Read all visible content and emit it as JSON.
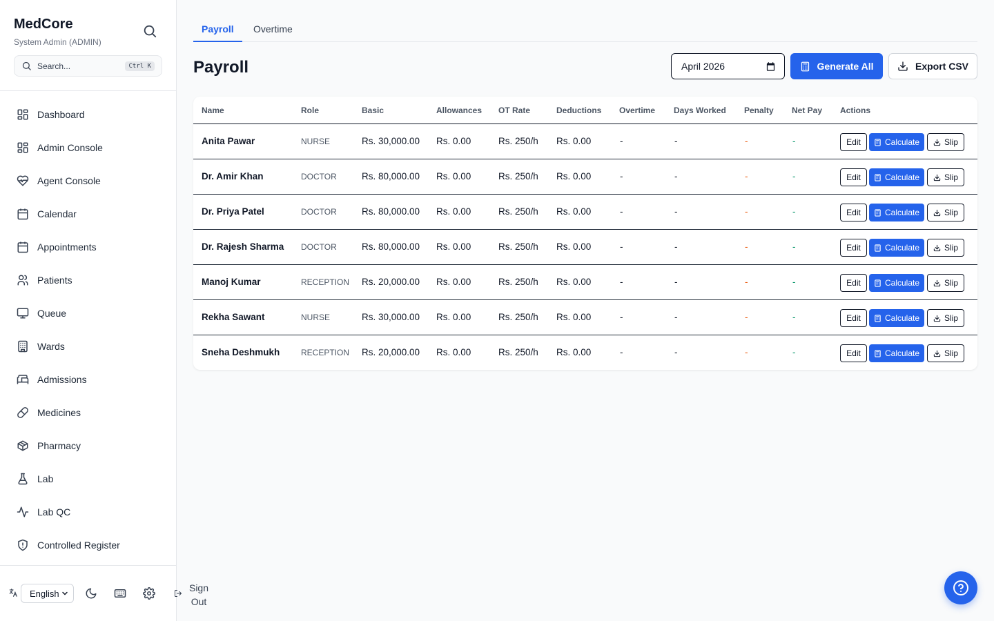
{
  "app": {
    "name": "MedCore",
    "user": "System Admin (ADMIN)"
  },
  "search": {
    "placeholder": "Search...",
    "shortcut": "Ctrl K"
  },
  "sidebar": {
    "items": [
      {
        "label": "Dashboard",
        "icon": "dashboard-icon"
      },
      {
        "label": "Admin Console",
        "icon": "admin-console-icon"
      },
      {
        "label": "Agent Console",
        "icon": "heart-pulse-icon"
      },
      {
        "label": "Calendar",
        "icon": "calendar-icon"
      },
      {
        "label": "Appointments",
        "icon": "calendar-icon"
      },
      {
        "label": "Patients",
        "icon": "users-icon"
      },
      {
        "label": "Queue",
        "icon": "monitor-icon"
      },
      {
        "label": "Wards",
        "icon": "building-icon"
      },
      {
        "label": "Admissions",
        "icon": "bed-icon"
      },
      {
        "label": "Medicines",
        "icon": "pill-icon"
      },
      {
        "label": "Pharmacy",
        "icon": "package-icon"
      },
      {
        "label": "Lab",
        "icon": "flask-icon"
      },
      {
        "label": "Lab QC",
        "icon": "activity-icon"
      },
      {
        "label": "Controlled Register",
        "icon": "shield-icon"
      }
    ]
  },
  "footer": {
    "language": "English",
    "signout": "Sign Out"
  },
  "tabs": [
    {
      "label": "Payroll",
      "active": true
    },
    {
      "label": "Overtime",
      "active": false
    }
  ],
  "page": {
    "title": "Payroll",
    "month": "April  2026",
    "generate_label": "Generate All",
    "export_label": "Export CSV"
  },
  "table": {
    "columns": [
      "Name",
      "Role",
      "Basic",
      "Allowances",
      "OT Rate",
      "Deductions",
      "Overtime",
      "Days Worked",
      "Penalty",
      "Net Pay",
      "Actions"
    ],
    "actions": {
      "edit": "Edit",
      "calculate": "Calculate",
      "slip": "Slip"
    },
    "rows": [
      {
        "name": "Anita Pawar",
        "role": "NURSE",
        "basic": "Rs. 30,000.00",
        "allowances": "Rs. 0.00",
        "ot_rate": "Rs. 250/h",
        "deductions": "Rs. 0.00",
        "overtime": "-",
        "days_worked": "-",
        "penalty": "-",
        "net_pay": "-"
      },
      {
        "name": "Dr. Amir Khan",
        "role": "DOCTOR",
        "basic": "Rs. 80,000.00",
        "allowances": "Rs. 0.00",
        "ot_rate": "Rs. 250/h",
        "deductions": "Rs. 0.00",
        "overtime": "-",
        "days_worked": "-",
        "penalty": "-",
        "net_pay": "-"
      },
      {
        "name": "Dr. Priya Patel",
        "role": "DOCTOR",
        "basic": "Rs. 80,000.00",
        "allowances": "Rs. 0.00",
        "ot_rate": "Rs. 250/h",
        "deductions": "Rs. 0.00",
        "overtime": "-",
        "days_worked": "-",
        "penalty": "-",
        "net_pay": "-"
      },
      {
        "name": "Dr. Rajesh Sharma",
        "role": "DOCTOR",
        "basic": "Rs. 80,000.00",
        "allowances": "Rs. 0.00",
        "ot_rate": "Rs. 250/h",
        "deductions": "Rs. 0.00",
        "overtime": "-",
        "days_worked": "-",
        "penalty": "-",
        "net_pay": "-"
      },
      {
        "name": "Manoj Kumar",
        "role": "RECEPTION",
        "basic": "Rs. 20,000.00",
        "allowances": "Rs. 0.00",
        "ot_rate": "Rs. 250/h",
        "deductions": "Rs. 0.00",
        "overtime": "-",
        "days_worked": "-",
        "penalty": "-",
        "net_pay": "-"
      },
      {
        "name": "Rekha Sawant",
        "role": "NURSE",
        "basic": "Rs. 30,000.00",
        "allowances": "Rs. 0.00",
        "ot_rate": "Rs. 250/h",
        "deductions": "Rs. 0.00",
        "overtime": "-",
        "days_worked": "-",
        "penalty": "-",
        "net_pay": "-"
      },
      {
        "name": "Sneha Deshmukh",
        "role": "RECEPTION",
        "basic": "Rs. 20,000.00",
        "allowances": "Rs. 0.00",
        "ot_rate": "Rs. 250/h",
        "deductions": "Rs. 0.00",
        "overtime": "-",
        "days_worked": "-",
        "penalty": "-",
        "net_pay": "-"
      }
    ]
  },
  "colors": {
    "accent": "#2563eb",
    "penalty": "#ea580c",
    "net_pay": "#059669"
  }
}
